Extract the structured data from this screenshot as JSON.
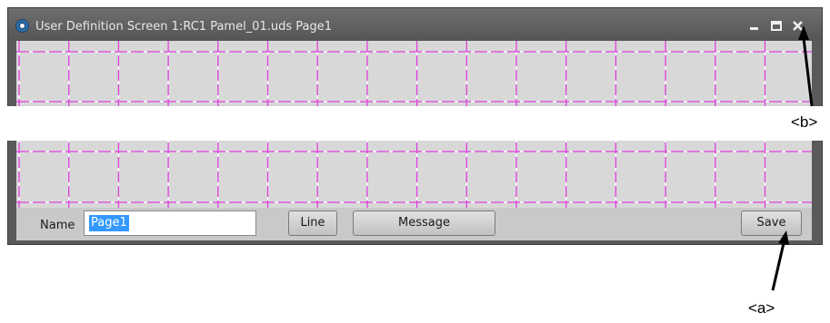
{
  "window": {
    "title": "User Definition Screen 1:RC1 Pamel_01.uds Page1",
    "controls": [
      "minimize-icon",
      "maximize-icon",
      "close-icon"
    ]
  },
  "canvas": {
    "background": "#d8d8d8",
    "grid_color": "#e040e0",
    "grid_style": "dashed"
  },
  "bottombar": {
    "name_label": "Name",
    "name_value": "Page1",
    "line_button": "Line",
    "message_button": "Message",
    "save_button": "Save"
  },
  "callouts": {
    "a": "<a>",
    "b": "<b>"
  }
}
